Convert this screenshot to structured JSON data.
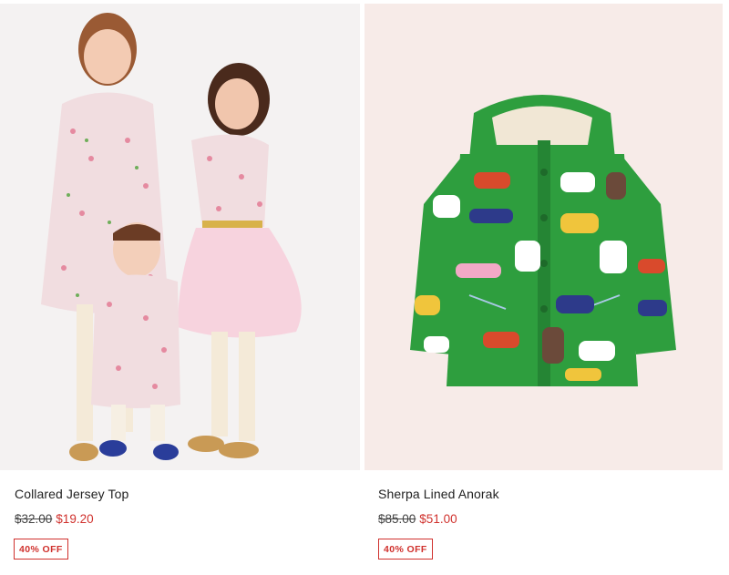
{
  "products": [
    {
      "name": "Collared Jersey Top",
      "original_price": "$32.00",
      "sale_price": "$19.20",
      "discount_badge": "40% OFF",
      "image_icon": "children-floral-dresses-photo"
    },
    {
      "name": "Sherpa Lined Anorak",
      "original_price": "$85.00",
      "sale_price": "$51.00",
      "discount_badge": "40% OFF",
      "image_icon": "green-animal-print-jacket-photo"
    }
  ],
  "colors": {
    "sale_red": "#d0312d",
    "text": "#222222",
    "jacket_green": "#2e9e3e"
  }
}
